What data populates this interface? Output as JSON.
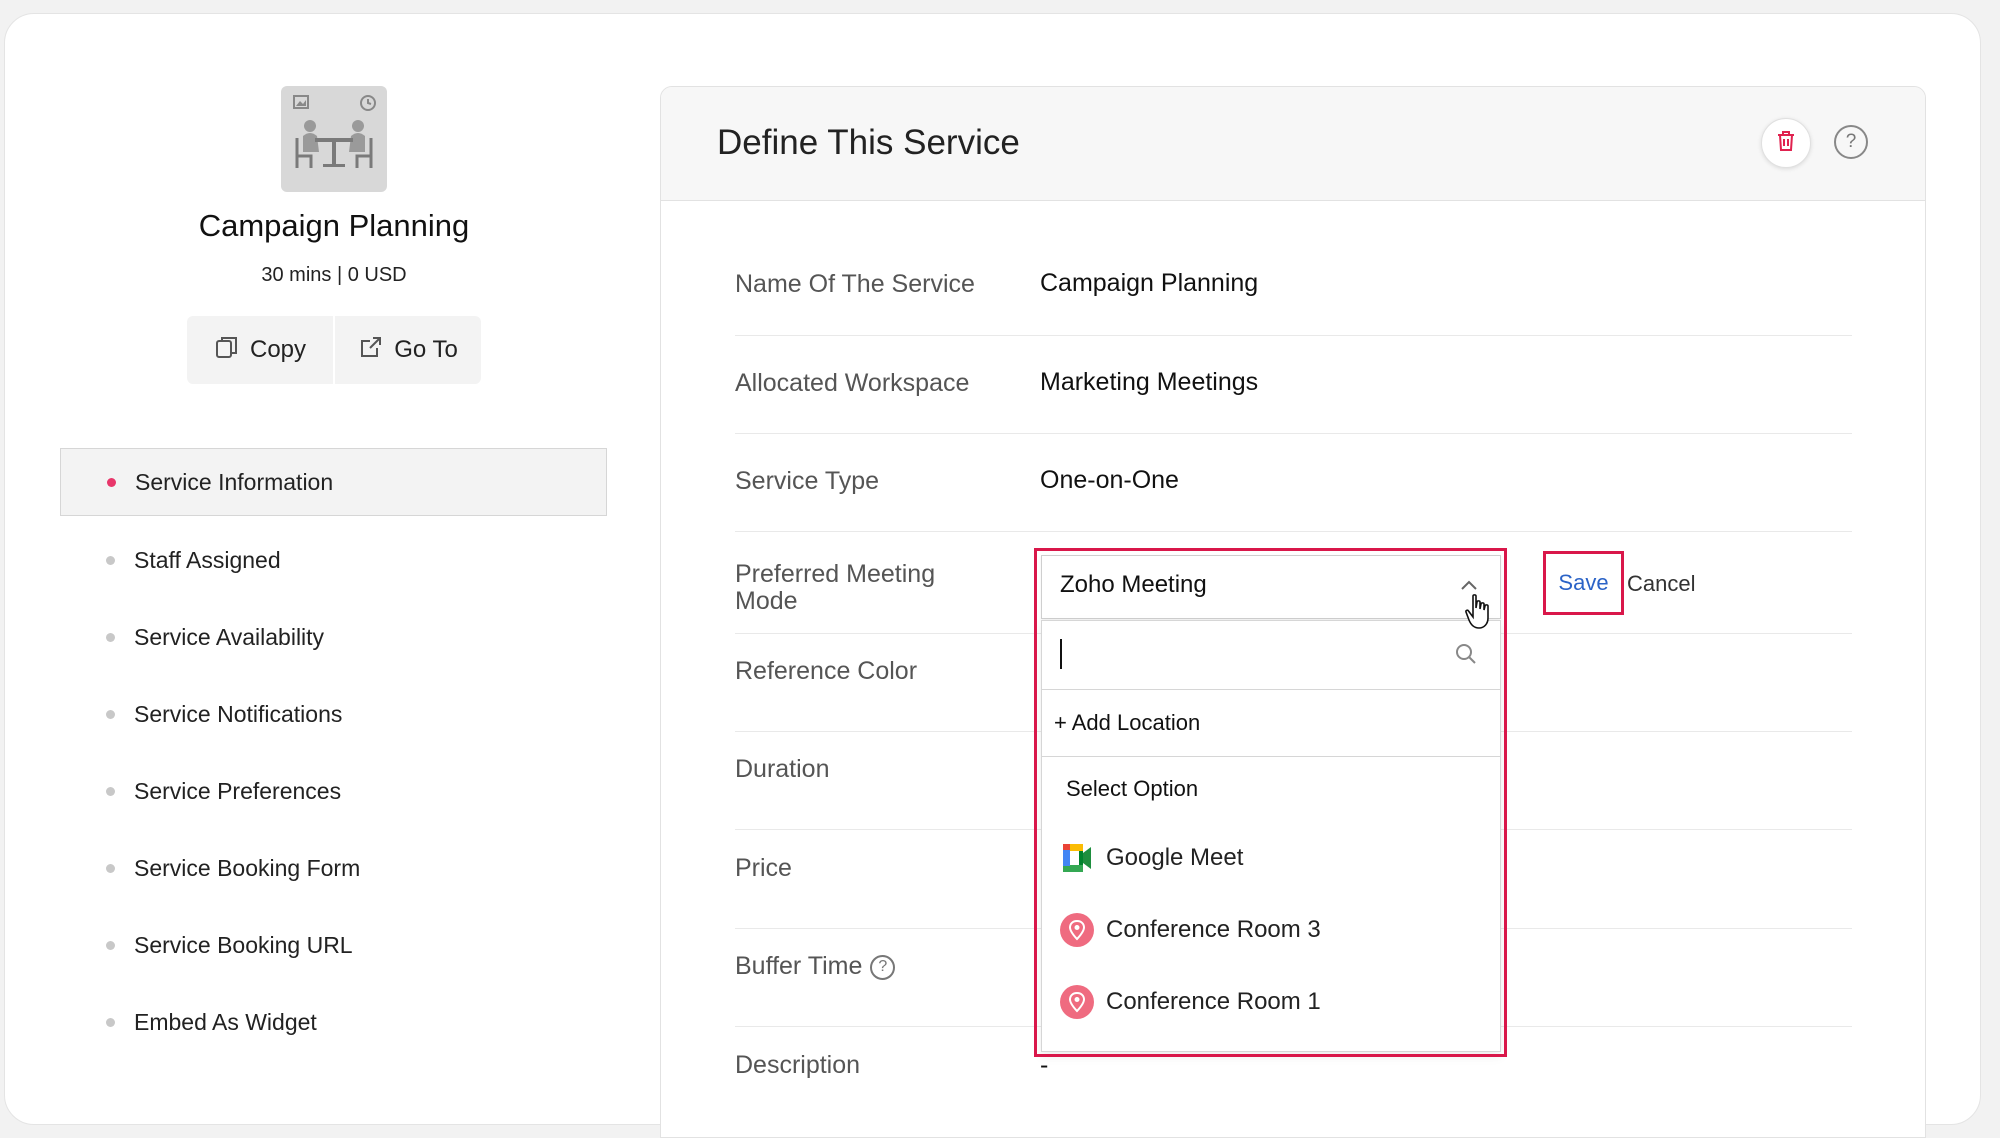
{
  "service_card": {
    "name": "Campaign Planning",
    "meta": "30 mins | 0 USD",
    "copy_label": "Copy",
    "goto_label": "Go To"
  },
  "nav": {
    "items": [
      {
        "label": "Service Information",
        "active": true
      },
      {
        "label": "Staff Assigned"
      },
      {
        "label": "Service Availability"
      },
      {
        "label": "Service Notifications"
      },
      {
        "label": "Service Preferences"
      },
      {
        "label": "Service Booking Form"
      },
      {
        "label": "Service Booking URL"
      },
      {
        "label": "Embed As Widget"
      }
    ]
  },
  "panel": {
    "title": "Define This Service",
    "icons": {
      "delete": "trash-icon",
      "help": "help-icon"
    }
  },
  "fields": {
    "name": {
      "label": "Name Of The Service",
      "value": "Campaign Planning"
    },
    "workspace": {
      "label": "Allocated Workspace",
      "value": "Marketing Meetings"
    },
    "type": {
      "label": "Service Type",
      "value": "One-on-One"
    },
    "meeting_mode": {
      "label": "Preferred Meeting Mode"
    },
    "color": {
      "label": "Reference Color"
    },
    "duration": {
      "label": "Duration"
    },
    "price": {
      "label": "Price"
    },
    "buffer": {
      "label": "Buffer Time"
    },
    "description": {
      "label": "Description",
      "value": "-"
    }
  },
  "meeting_dropdown": {
    "selected": "Zoho Meeting",
    "search_value": "",
    "add_location": "+ Add Location",
    "options": [
      {
        "label": "Select Option"
      },
      {
        "label": "Google Meet",
        "icon": "google-meet-icon"
      },
      {
        "label": "Conference Room 3",
        "icon": "location-pin-icon"
      },
      {
        "label": "Conference Room 1",
        "icon": "location-pin-icon"
      }
    ]
  },
  "actions": {
    "save": "Save",
    "cancel": "Cancel"
  },
  "colors": {
    "accent_pink": "#e8366a",
    "highlight_red": "#d9174a",
    "link_blue": "#2b63c7"
  }
}
